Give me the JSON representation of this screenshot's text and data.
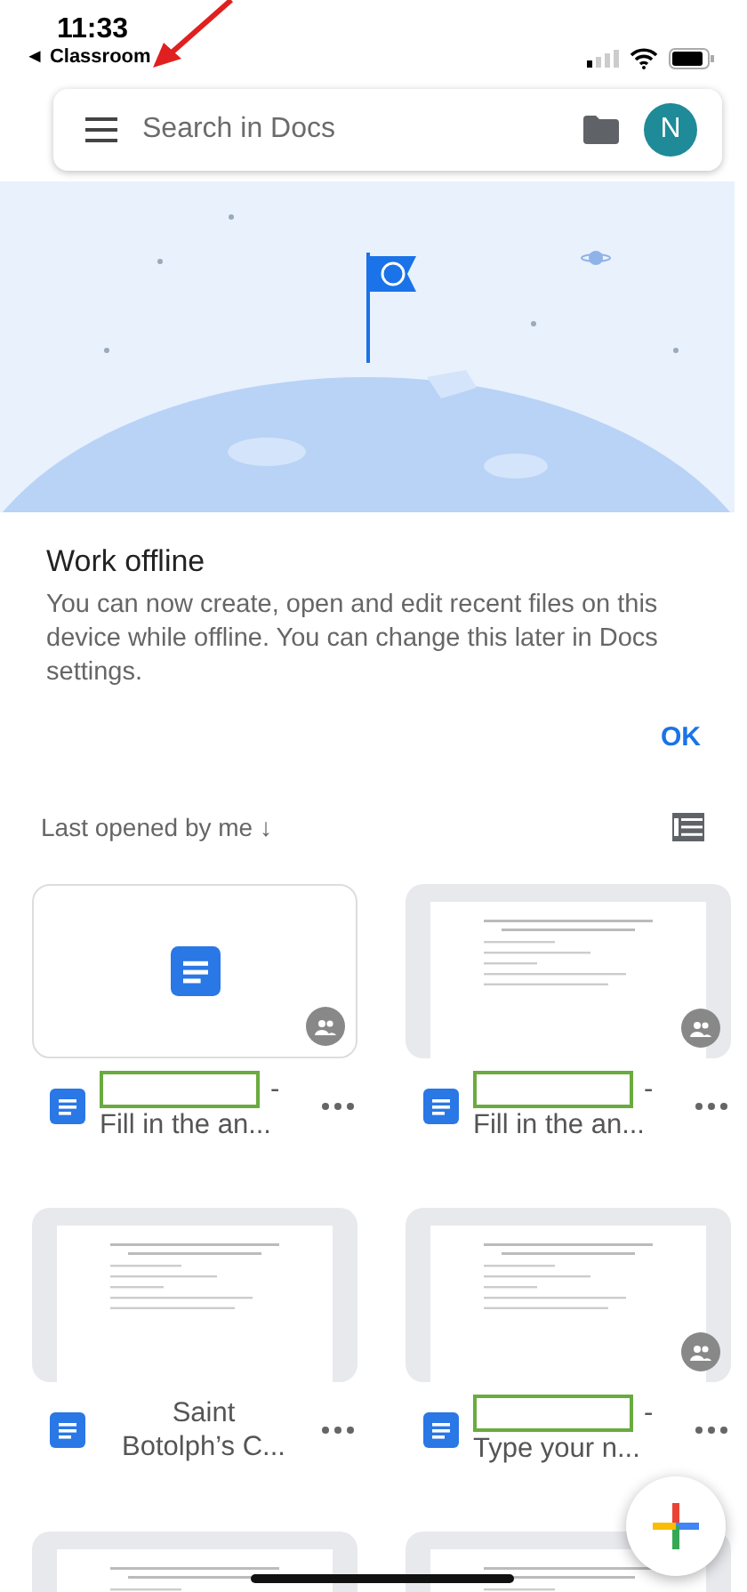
{
  "status_bar": {
    "time": "11:33",
    "back_label": "◄ Classroom"
  },
  "search": {
    "placeholder": "Search in Docs",
    "avatar": "N"
  },
  "offline_card": {
    "title": "Work offline",
    "body": "You can now create, open and edit recent files on this device while offline. You can change this later in Docs settings.",
    "action": "OK"
  },
  "sort": {
    "label": "Last opened by me",
    "arrow": "↓"
  },
  "files": [
    {
      "kind": "icon",
      "shared": true,
      "redacted": true,
      "title_lines": [
        "-",
        "Fill in the an..."
      ]
    },
    {
      "kind": "page",
      "shared": true,
      "redacted": true,
      "title_lines": [
        "-",
        "Fill in the an..."
      ]
    },
    {
      "kind": "page",
      "shared": false,
      "redacted": false,
      "title_lines": [
        "Saint",
        "Botolph’s C..."
      ]
    },
    {
      "kind": "page",
      "shared": true,
      "redacted": true,
      "title_lines": [
        "-",
        "Type your n..."
      ]
    },
    {
      "kind": "page"
    },
    {
      "kind": "page"
    }
  ]
}
